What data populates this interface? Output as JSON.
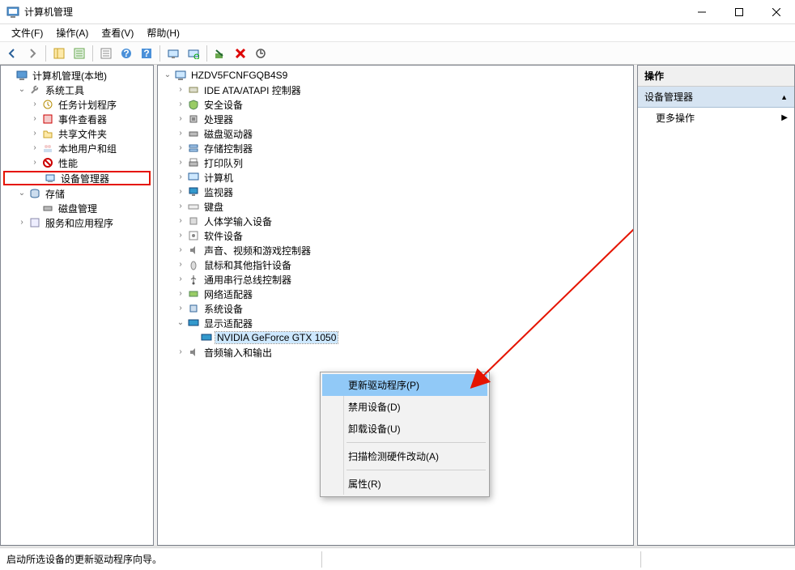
{
  "window": {
    "title": "计算机管理"
  },
  "menus": {
    "file": "文件(F)",
    "action": "操作(A)",
    "view": "查看(V)",
    "help": "帮助(H)"
  },
  "left_tree": {
    "root": "计算机管理(本地)",
    "system_tools": "系统工具",
    "task_scheduler": "任务计划程序",
    "event_viewer": "事件查看器",
    "shared_folders": "共享文件夹",
    "local_users": "本地用户和组",
    "performance": "性能",
    "device_manager": "设备管理器",
    "storage": "存储",
    "disk_mgmt": "磁盘管理",
    "services_apps": "服务和应用程序"
  },
  "device_tree": {
    "computer": "HZDV5FCNFGQB4S9",
    "ide": "IDE ATA/ATAPI 控制器",
    "security": "安全设备",
    "cpu": "处理器",
    "disk": "磁盘驱动器",
    "storage_ctl": "存储控制器",
    "print_queue": "打印队列",
    "computers": "计算机",
    "monitor": "监视器",
    "keyboard": "键盘",
    "hid": "人体学输入设备",
    "software_dev": "软件设备",
    "sound": "声音、视频和游戏控制器",
    "mouse": "鼠标和其他指针设备",
    "usb": "通用串行总线控制器",
    "network": "网络适配器",
    "system_dev": "系统设备",
    "display": "显示适配器",
    "gpu": "NVIDIA GeForce GTX 1050",
    "audio": "音频输入和输出"
  },
  "context_menu": {
    "update": "更新驱动程序(P)",
    "disable": "禁用设备(D)",
    "uninstall": "卸载设备(U)",
    "scan": "扫描检测硬件改动(A)",
    "properties": "属性(R)"
  },
  "right_panel": {
    "heading": "操作",
    "section": "设备管理器",
    "more": "更多操作"
  },
  "status": "启动所选设备的更新驱动程序向导。"
}
